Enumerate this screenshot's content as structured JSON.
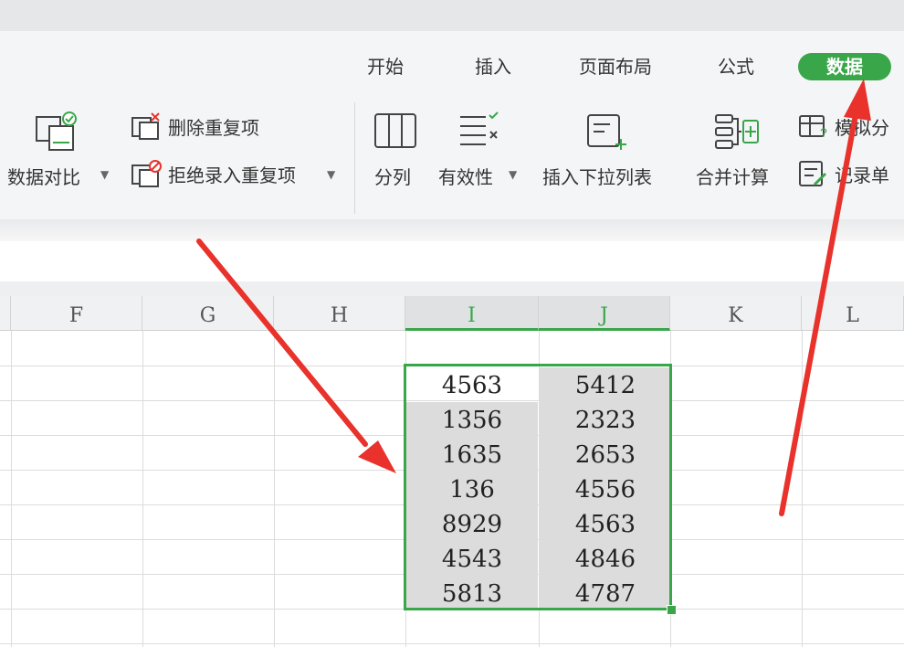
{
  "ribbon": {
    "tabs": [
      {
        "id": "start",
        "label": "开始",
        "active": false
      },
      {
        "id": "insert",
        "label": "插入",
        "active": false
      },
      {
        "id": "page-layout",
        "label": "页面布局",
        "active": false
      },
      {
        "id": "formula",
        "label": "公式",
        "active": false
      },
      {
        "id": "data",
        "label": "数据",
        "active": true
      }
    ],
    "buttons": {
      "data_compare": {
        "label": "数据对比",
        "icon": "data-compare-icon"
      },
      "remove_duplicates": {
        "label": "删除重复项",
        "icon": "remove-duplicates-icon"
      },
      "reject_duplicates": {
        "label": "拒绝录入重复项",
        "icon": "reject-duplicates-icon"
      },
      "split_column": {
        "label": "分列",
        "icon": "split-column-icon"
      },
      "validation": {
        "label": "有效性",
        "icon": "validation-icon"
      },
      "insert_dropdown": {
        "label": "插入下拉列表",
        "icon": "insert-dropdown-icon"
      },
      "consolidate": {
        "label": "合并计算",
        "icon": "consolidate-icon"
      },
      "simulate": {
        "label": "模拟分",
        "icon": "simulation-icon"
      },
      "record_form": {
        "label": "记录单",
        "icon": "record-form-icon"
      }
    }
  },
  "sheet": {
    "columns": [
      "F",
      "G",
      "H",
      "I",
      "J",
      "K",
      "L"
    ],
    "selected_columns": [
      "I",
      "J"
    ],
    "column_I_values": [
      "4563",
      "1356",
      "1635",
      "136",
      "8929",
      "4543",
      "5813"
    ],
    "column_J_values": [
      "5412",
      "2323",
      "2653",
      "4556",
      "4563",
      "4846",
      "4787"
    ]
  },
  "colors": {
    "accent": "#3aa64a",
    "annotation_arrow": "#e8322b",
    "selection_fill": "#dcdcdc"
  }
}
